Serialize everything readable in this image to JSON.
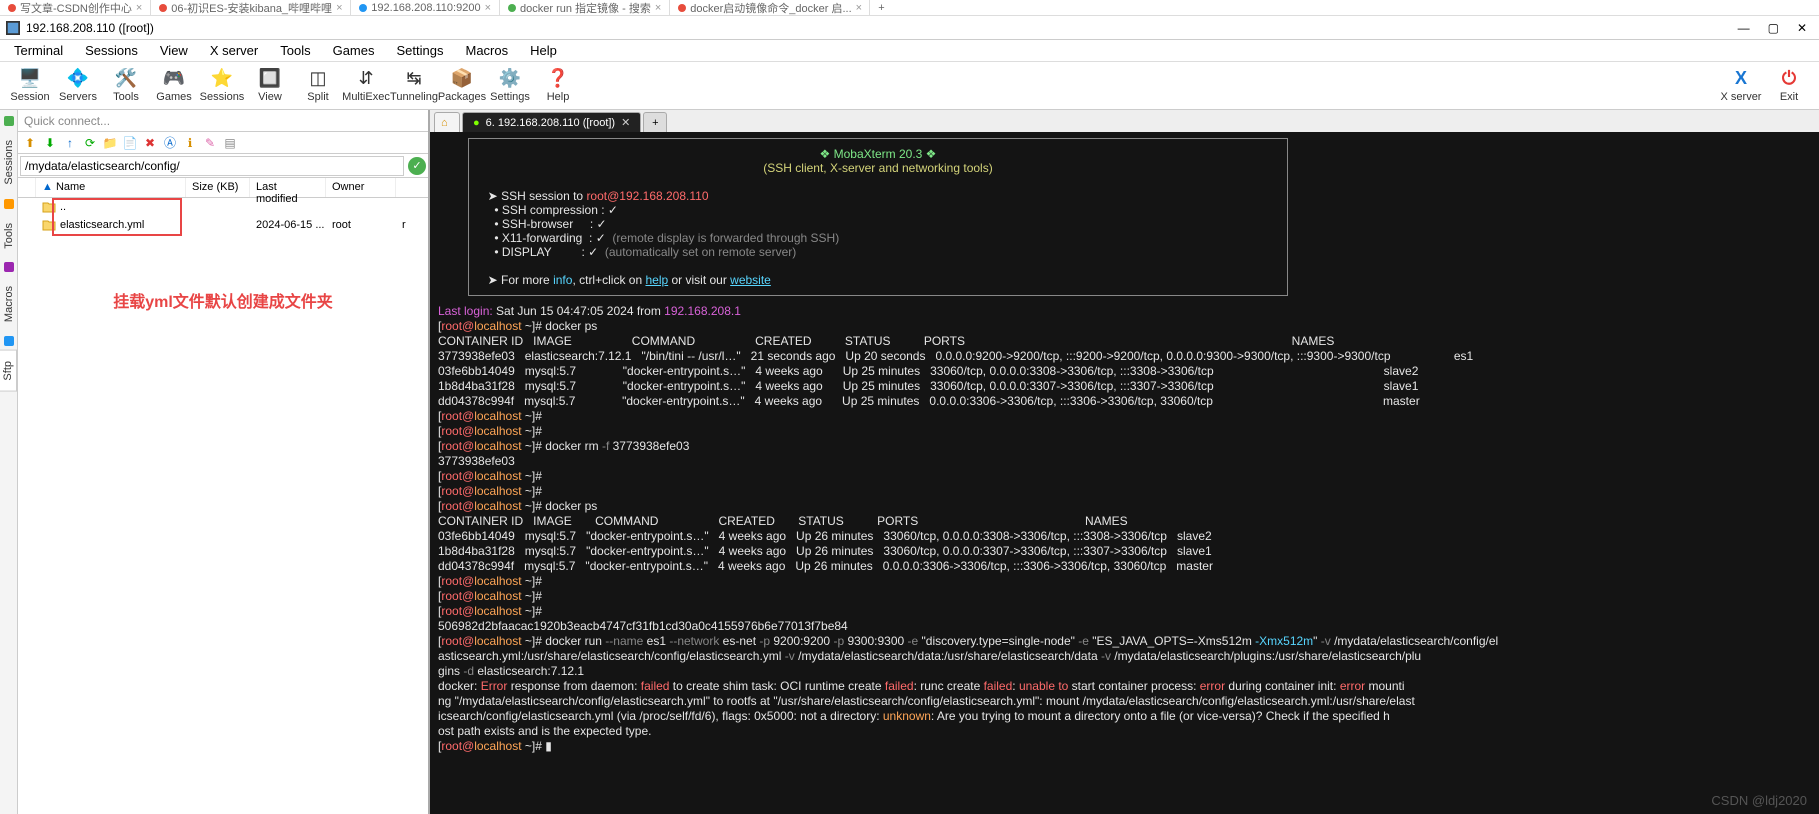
{
  "browser_tabs": [
    {
      "label": "写文章-CSDN创作中心",
      "color": "#e74c3c",
      "close": true
    },
    {
      "label": "06-初识ES-安装kibana_哔哩哔哩",
      "color": "#e74c3c",
      "close": true
    },
    {
      "label": "192.168.208.110:9200",
      "color": "#2196f3",
      "close": true
    },
    {
      "label": "docker run 指定镜像 - 搜索",
      "color": "#4caf50",
      "close": true
    },
    {
      "label": "docker启动镜像命令_docker 启...",
      "color": "#e74c3c",
      "close": true
    },
    {
      "label": "+",
      "color": "",
      "close": false
    }
  ],
  "window_title": "192.168.208.110 ([root])",
  "menus": [
    "Terminal",
    "Sessions",
    "View",
    "X server",
    "Tools",
    "Games",
    "Settings",
    "Macros",
    "Help"
  ],
  "toolbar": [
    {
      "name": "session",
      "label": "Session",
      "glyph": "🖥️"
    },
    {
      "name": "servers",
      "label": "Servers",
      "glyph": "💠"
    },
    {
      "name": "tools",
      "label": "Tools",
      "glyph": "🛠️"
    },
    {
      "name": "games",
      "label": "Games",
      "glyph": "🎮"
    },
    {
      "name": "sessions",
      "label": "Sessions",
      "glyph": "⭐"
    },
    {
      "name": "view",
      "label": "View",
      "glyph": "🔲"
    },
    {
      "name": "split",
      "label": "Split",
      "glyph": "◫"
    },
    {
      "name": "multiexec",
      "label": "MultiExec",
      "glyph": "⇵"
    },
    {
      "name": "tunneling",
      "label": "Tunneling",
      "glyph": "↹"
    },
    {
      "name": "packages",
      "label": "Packages",
      "glyph": "📦"
    },
    {
      "name": "settings",
      "label": "Settings",
      "glyph": "⚙️"
    },
    {
      "name": "help",
      "label": "Help",
      "glyph": "❓"
    }
  ],
  "toolbar_right": [
    {
      "name": "xserver",
      "label": "X server",
      "glyph": "X",
      "color": "#1976d2"
    },
    {
      "name": "exit",
      "label": "Exit",
      "glyph": "⏻",
      "color": "#e53935"
    }
  ],
  "side_tabs": [
    "Sessions",
    "Tools",
    "Macros",
    "Sftp"
  ],
  "sftp": {
    "quick": "Quick connect...",
    "path": "/mydata/elasticsearch/config/",
    "cols": {
      "name": "Name",
      "size": "Size (KB)",
      "mod": "Last modified",
      "own": "Owner"
    },
    "rows": [
      {
        "name": "..",
        "size": "",
        "mod": "",
        "own": "",
        "icon": "folder-up"
      },
      {
        "name": "elasticsearch.yml",
        "size": "",
        "mod": "2024-06-15 ...",
        "own": "root",
        "r": "r",
        "icon": "folder"
      }
    ],
    "note": "挂载yml文件默认创建成文件夹"
  },
  "term_tabs": {
    "home": "⌂",
    "active": "6. 192.168.208.110 ([root])",
    "close": "✕",
    "add": "+"
  },
  "banner": {
    "title": "❖ MobaXterm 20.3 ❖",
    "sub": "(SSH client, X-server and networking tools)",
    "arrow": "➤ ",
    "session_pre": "SSH session to ",
    "session_host": "root@192.168.208.110",
    "l1": "• SSH compression : ✓",
    "l2": "• SSH-browser     : ✓",
    "l3a": "• X11-forwarding  : ✓  ",
    "l3b": "(remote display is forwarded through SSH)",
    "l4a": "• DISPLAY         : ✓  ",
    "l4b": "(automatically set on remote server)",
    "more1": "➤ For more ",
    "info": "info",
    "more2": ", ctrl+click on ",
    "help": "help",
    "more3": " or visit our ",
    "website": "website"
  },
  "t": {
    "lastlogin_a": "Last login:",
    "lastlogin_b": " Sat Jun 15 04:47:05 2024 from ",
    "lastlogin_c": "192.168.208.1",
    "prompt_user": "root@",
    "prompt_host": "localhost",
    "prompt_tail": " ~]# ",
    "prompt_open": "[",
    "cmd_ps": "docker ps",
    "hdr1": "CONTAINER ID   IMAGE                  COMMAND                  CREATED          STATUS          PORTS                                                                                                  NAMES",
    "r1": "3773938efe03   elasticsearch:7.12.1   \"/bin/tini -- /usr/l…\"   21 seconds ago   Up 20 seconds   0.0.0.0:9200->9200/tcp, :::9200->9200/tcp, 0.0.0.0:9300->9300/tcp, :::9300->9300/tcp                   es1",
    "r2": "03fe6bb14049   mysql:5.7              \"docker-entrypoint.s…\"   4 weeks ago      Up 25 minutes   33060/tcp, 0.0.0.0:3308->3306/tcp, :::3308->3306/tcp                                                   slave2",
    "r3": "1b8d4ba31f28   mysql:5.7              \"docker-entrypoint.s…\"   4 weeks ago      Up 25 minutes   33060/tcp, 0.0.0.0:3307->3306/tcp, :::3307->3306/tcp                                                   slave1",
    "r4": "dd04378c994f   mysql:5.7              \"docker-entrypoint.s…\"   4 weeks ago      Up 25 minutes   0.0.0.0:3306->3306/tcp, :::3306->3306/tcp, 33060/tcp                                                   master",
    "cmd_rm_a": "docker rm ",
    "cmd_rm_flag": "-f",
    "cmd_rm_b": " 3773938efe03",
    "rm_out": "3773938efe03",
    "hdr2": "CONTAINER ID   IMAGE       COMMAND                  CREATED       STATUS          PORTS                                                  NAMES",
    "s1": "03fe6bb14049   mysql:5.7   \"docker-entrypoint.s…\"   4 weeks ago   Up 26 minutes   33060/tcp, 0.0.0.0:3308->3306/tcp, :::3308->3306/tcp   slave2",
    "s2": "1b8d4ba31f28   mysql:5.7   \"docker-entrypoint.s…\"   4 weeks ago   Up 26 minutes   33060/tcp, 0.0.0.0:3307->3306/tcp, :::3307->3306/tcp   slave1",
    "s3": "dd04378c994f   mysql:5.7   \"docker-entrypoint.s…\"   4 weeks ago   Up 26 minutes   0.0.0.0:3306->3306/tcp, :::3306->3306/tcp, 33060/tcp   master",
    "hash": "506982d2bfaacac1920b3eacb4747cf31fb1cd30a0c4155976b6e77013f7be84",
    "run1a": "docker run ",
    "run_name": "--name",
    "run1b": " es1 ",
    "run_net": "--network",
    "run1c": " es-net ",
    "run_p": "-p",
    "run1d": " 9200:9200 ",
    "run1e": " 9300:9300 ",
    "run_e": "-e",
    "run1f": " \"discovery.type=single-node\" ",
    "run1g": " \"ES_JAVA_OPTS=-Xms512m ",
    "run_xmx": "-Xmx512m",
    "run1h": "\" ",
    "run_v": "-v",
    "run1i": " /mydata/elasticsearch/config/el",
    "run2": "asticsearch.yml:/usr/share/elasticsearch/config/elasticsearch.yml ",
    "run2a": " /mydata/elasticsearch/data:/usr/share/elasticsearch/data ",
    "run2b": " /mydata/elasticsearch/plugins:/usr/share/elasticsearch/plu",
    "run2c": "gins ",
    "run_d": "-d",
    "run2d": " elasticsearch:7.12.1",
    "err_a": "docker: ",
    "err_b": "Error",
    "err_c": " response from daemon: ",
    "err_d": "failed",
    "err_e": " to create shim task: OCI runtime create ",
    "err_f": "failed",
    "err_g": ": runc create ",
    "err_h": "failed",
    "err_i": ": ",
    "err_j": "unable to",
    "err_k": " start container process: ",
    "err_l": "error",
    "err_m": " during container init: ",
    "err_n": "error",
    "err_o": " mounti",
    "err2": "ng \"/mydata/elasticsearch/config/elasticsearch.yml\" to rootfs at \"/usr/share/elasticsearch/config/elasticsearch.yml\": mount /mydata/elasticsearch/config/elasticsearch.yml:/usr/share/elast",
    "err3a": "icsearch/config/elasticsearch.yml (via /proc/self/fd/6), flags: 0x5000: not a directory: ",
    "err3b": "unknown",
    "err3c": ": Are you trying to mount a directory onto a file (or vice-versa)? Check if the specified h",
    "err4": "ost path exists and is the expected type.",
    "cursor": "▮"
  },
  "watermark": "CSDN @ldj2020"
}
